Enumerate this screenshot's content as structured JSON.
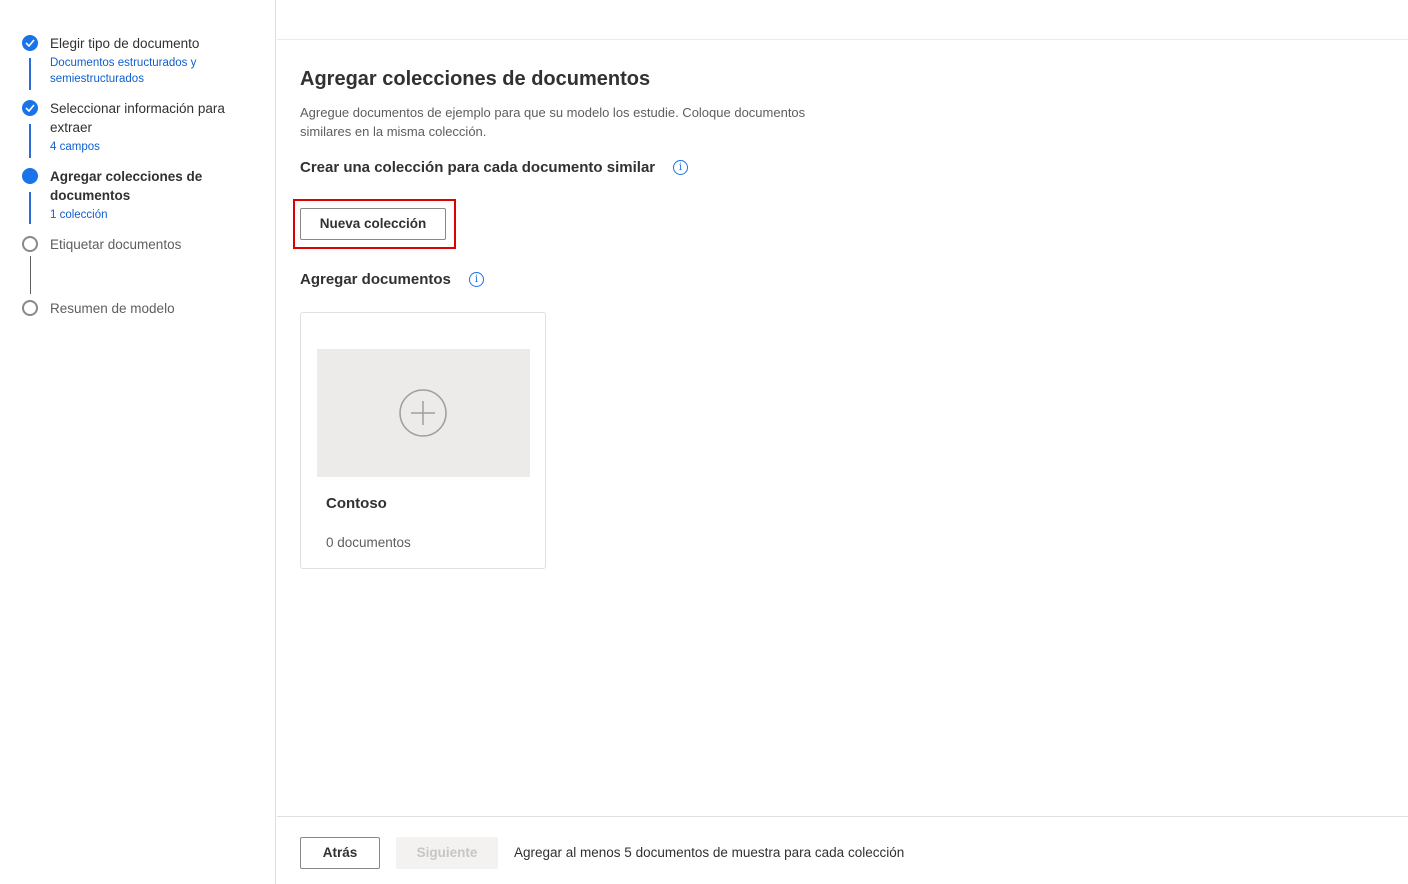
{
  "sidebar": {
    "steps": [
      {
        "title": "Elegir tipo de documento",
        "subtitle": "Documentos estructurados y semiestructurados",
        "state": "done"
      },
      {
        "title": "Seleccionar información para extraer",
        "subtitle": "4 campos",
        "state": "done"
      },
      {
        "title": "Agregar colecciones de documentos",
        "subtitle": "1 colección",
        "state": "current"
      },
      {
        "title": "Etiquetar documentos",
        "subtitle": "",
        "state": "todo"
      },
      {
        "title": "Resumen de modelo",
        "subtitle": "",
        "state": "todo"
      }
    ]
  },
  "main": {
    "title": "Agregar colecciones de documentos",
    "description": "Agregue documentos de ejemplo para que su modelo los estudie. Coloque documentos similares en la misma colección.",
    "create_section_title": "Crear una colección para cada documento similar",
    "new_collection_label": "Nueva colección",
    "add_docs_section_title": "Agregar documentos",
    "collections": [
      {
        "name": "Contoso",
        "count_label": "0 documentos"
      }
    ]
  },
  "footer": {
    "back_label": "Atrás",
    "next_label": "Siguiente",
    "message": "Agregar al menos 5 documentos de muestra para cada colección"
  },
  "colors": {
    "accent": "#1a73e8",
    "highlight": "#e00000"
  },
  "icons": {
    "step_done": "checkmark-circle-icon",
    "step_current": "filled-circle-icon",
    "step_todo": "empty-circle-icon",
    "info": "info-icon",
    "add": "plus-circle-icon"
  }
}
